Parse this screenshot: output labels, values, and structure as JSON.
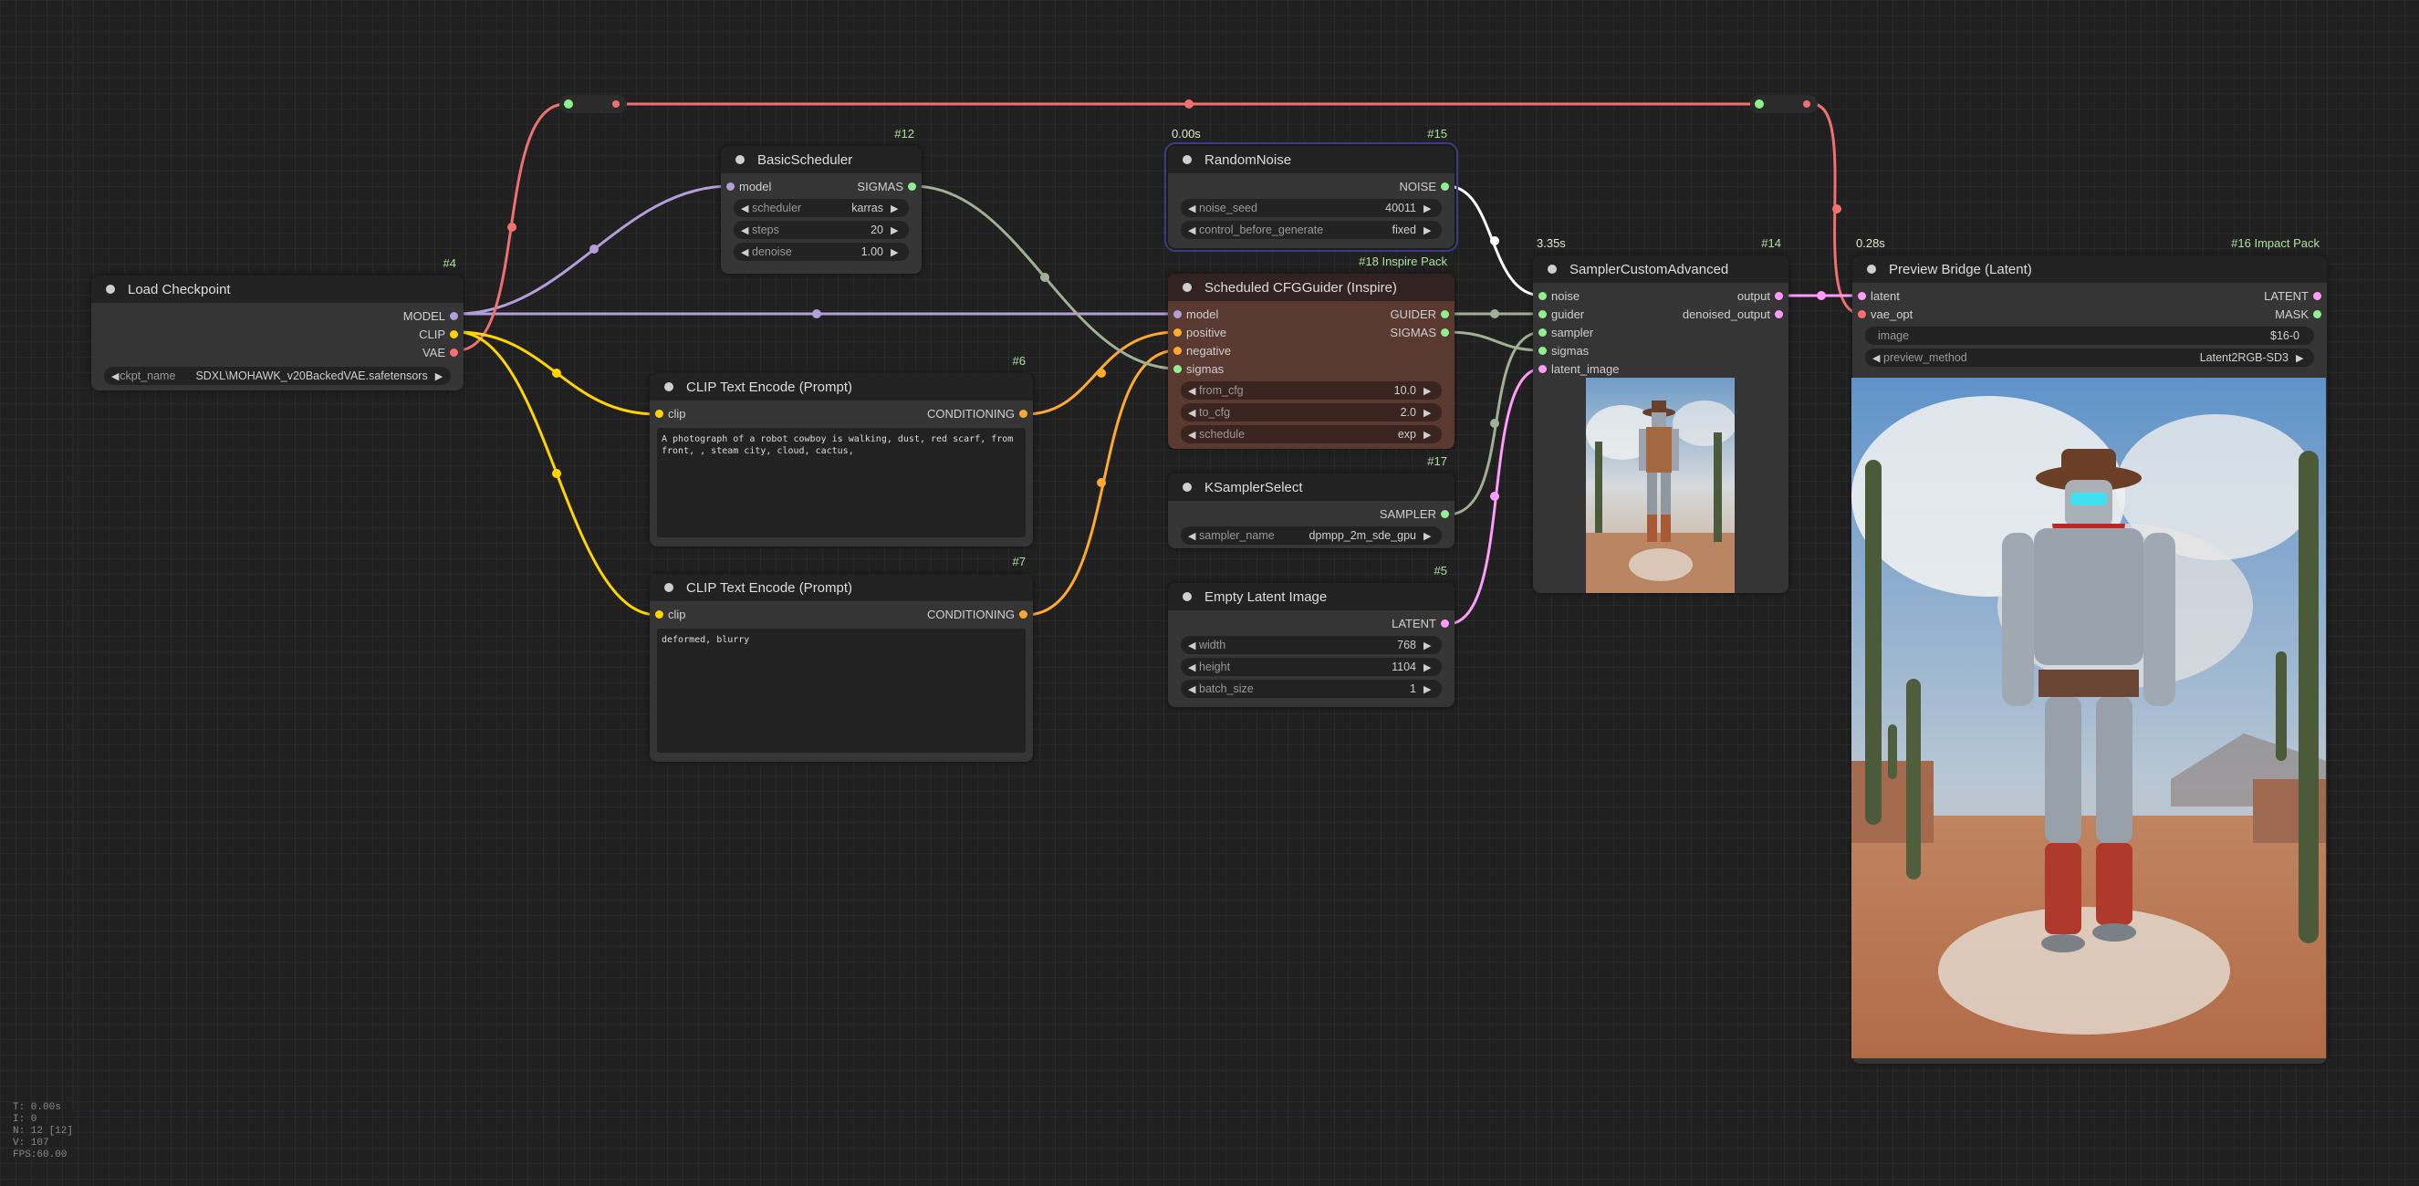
{
  "stats": {
    "t": "T: 0.00s",
    "i": "I: 0",
    "n": "N: 12 [12]",
    "v": "V: 107",
    "fps": "FPS:60.00"
  },
  "nodes": {
    "load_checkpoint": {
      "id": "#4",
      "title": "Load Checkpoint",
      "outputs": [
        "MODEL",
        "CLIP",
        "VAE"
      ],
      "ckpt_label": "ckpt_name",
      "ckpt_value": "SDXL\\MOHAWK_v20BackedVAE.safetensors"
    },
    "basic_scheduler": {
      "id": "#12",
      "title": "BasicScheduler",
      "input": "model",
      "output": "SIGMAS",
      "widgets": [
        {
          "label": "scheduler",
          "value": "karras"
        },
        {
          "label": "steps",
          "value": "20"
        },
        {
          "label": "denoise",
          "value": "1.00"
        }
      ]
    },
    "random_noise": {
      "id": "#15",
      "time": "0.00s",
      "title": "RandomNoise",
      "output": "NOISE",
      "widgets": [
        {
          "label": "noise_seed",
          "value": "40011"
        },
        {
          "label": "control_before_generate",
          "value": "fixed"
        }
      ]
    },
    "cfg_guider": {
      "id": "#18 Inspire Pack",
      "title": "Scheduled CFGGuider (Inspire)",
      "inputs": [
        "model",
        "positive",
        "negative",
        "sigmas"
      ],
      "outputs": [
        "GUIDER",
        "SIGMAS"
      ],
      "widgets": [
        {
          "label": "from_cfg",
          "value": "10.0"
        },
        {
          "label": "to_cfg",
          "value": "2.0"
        },
        {
          "label": "schedule",
          "value": "exp"
        }
      ]
    },
    "clip_pos": {
      "id": "#6",
      "title": "CLIP Text Encode (Prompt)",
      "input": "clip",
      "output": "CONDITIONING",
      "text": "A photograph of a robot cowboy is walking, dust, red scarf, from front, , steam city, cloud, cactus,"
    },
    "clip_neg": {
      "id": "#7",
      "title": "CLIP Text Encode (Prompt)",
      "input": "clip",
      "output": "CONDITIONING",
      "text": "deformed, blurry"
    },
    "ksampler_select": {
      "id": "#17",
      "title": "KSamplerSelect",
      "output": "SAMPLER",
      "widgets": [
        {
          "label": "sampler_name",
          "value": "dpmpp_2m_sde_gpu"
        }
      ]
    },
    "empty_latent": {
      "id": "#5",
      "title": "Empty Latent Image",
      "output": "LATENT",
      "widgets": [
        {
          "label": "width",
          "value": "768"
        },
        {
          "label": "height",
          "value": "1104"
        },
        {
          "label": "batch_size",
          "value": "1"
        }
      ]
    },
    "sampler_custom": {
      "id": "#14",
      "time": "3.35s",
      "title": "SamplerCustomAdvanced",
      "inputs": [
        "noise",
        "guider",
        "sampler",
        "sigmas",
        "latent_image"
      ],
      "outputs": [
        "output",
        "denoised_output"
      ]
    },
    "preview_bridge": {
      "id": "#16 Impact Pack",
      "time": "0.28s",
      "title": "Preview Bridge (Latent)",
      "inputs": [
        "latent",
        "vae_opt"
      ],
      "outputs": [
        "LATENT",
        "MASK"
      ],
      "image_label": "image",
      "image_value": "$16-0",
      "method_label": "preview_method",
      "method_value": "Latent2RGB-SD3"
    }
  },
  "colors": {
    "model": "#b39ddb",
    "clip": "#ffd500",
    "vae": "#ff6e6e",
    "conditioning": "#ffa931",
    "sigmas": "#9fb095",
    "noise": "#ffffff",
    "guider": "#66ffa0",
    "sampler": "#9fb095",
    "latent": "#ff9cf9",
    "cfg_bg": "#593930"
  },
  "icons": {
    "left_arrow": "◀",
    "right_arrow": "▶"
  }
}
